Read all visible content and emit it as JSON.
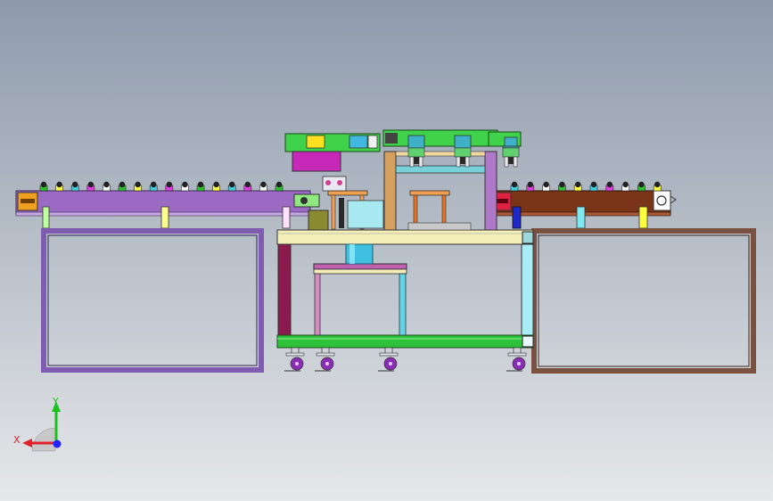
{
  "viewport": {
    "background_top": "#8e9aac",
    "background_bottom": "#e6e8ea"
  },
  "triad": {
    "x_label": "X",
    "y_label": "Y",
    "x_color": "#e0202a",
    "y_color": "#19c21c",
    "z_color": "#2424ff"
  },
  "assembly": {
    "left_conveyor_color": "#9b6bc4",
    "right_conveyor_color": "#7a3418",
    "left_frame_color": "#7f5cb2",
    "right_frame_color": "#7a5040",
    "center_table_color": "#f3eeb8",
    "center_base_color": "#2ec23a",
    "column_cyan": "#a8ecf5",
    "column_maroon": "#8a1b4e",
    "gantry_green": "#3fd24a",
    "caster_color": "#8b2cb4",
    "pallet_count_left": 16,
    "pallet_count_right": 10
  }
}
